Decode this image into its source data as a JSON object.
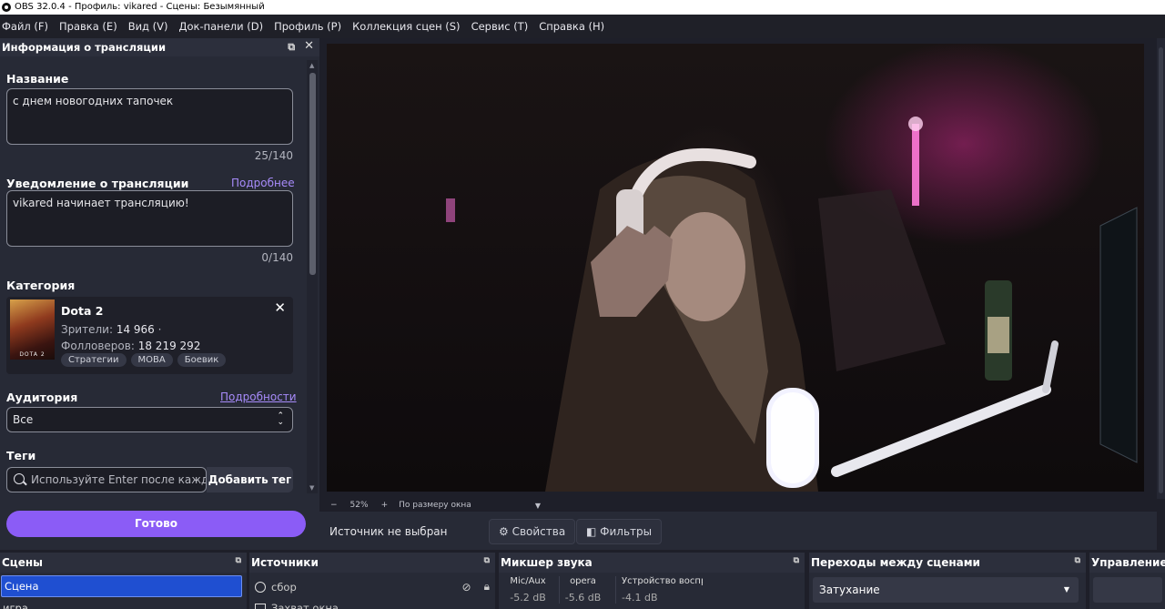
{
  "window": {
    "title": "OBS 32.0.4 - Профиль: vikared - Сцены: Безымянный"
  },
  "menu": [
    "Файл (F)",
    "Правка (E)",
    "Вид (V)",
    "Док-панели (D)",
    "Профиль (P)",
    "Коллекция сцен (S)",
    "Сервис (T)",
    "Справка (H)"
  ],
  "stream_info": {
    "header": "Информация о трансляции",
    "title_label": "Название",
    "title_value": "с днем новогодних тапочек",
    "title_count": "25/140",
    "notify_label": "Уведомление о трансляции",
    "notify_link": "Подробнее",
    "notify_value": "vikared начинает трансляцию!",
    "notify_count": "0/140",
    "category_label": "Категория",
    "category": {
      "name": "Dota 2",
      "viewers_label": "Зрители:",
      "viewers_value": "14 966",
      "viewers_dot": "·",
      "followers_label": "Фолловеров:",
      "followers_value": "18 219 292",
      "tags": [
        "Стратегии",
        "MOBA",
        "Боевик"
      ],
      "cover_text": "DOTA 2"
    },
    "audience_label": "Аудитория",
    "audience_link": "Подробности",
    "audience_value": "Все",
    "tags_label": "Теги",
    "tags_placeholder": "Используйте Enter после кажд",
    "add_tag_button": "Добавить тег",
    "done_button": "Готово"
  },
  "preview": {
    "zoom_minus": "−",
    "zoom": "52%",
    "zoom_plus": "+",
    "fit": "По размеру окна",
    "fit_arrow": "▼"
  },
  "source_bar": {
    "no_source": "Источник не выбран",
    "properties": "Свойства",
    "filters": "Фильтры"
  },
  "docks": {
    "scenes": {
      "title": "Сцены",
      "items": [
        "Сцена",
        "игра"
      ]
    },
    "sources": {
      "title": "Источники",
      "items": [
        "сбор",
        "Захват окна"
      ]
    },
    "mixer": {
      "title": "Микшер звука",
      "channels": [
        {
          "name": "Mic/Aux",
          "db": "-5.2 dB"
        },
        {
          "name": "opera",
          "db": "-5.6 dB"
        },
        {
          "name": "Устройство воспро",
          "db": "-4.1 dB"
        }
      ]
    },
    "transitions": {
      "title": "Переходы между сценами",
      "value": "Затухание"
    },
    "controls": {
      "title": "Управление"
    }
  },
  "colors": {
    "accent": "#8b5cf6",
    "link": "#a78bfa",
    "selected_scene": "#1f4fd1"
  }
}
